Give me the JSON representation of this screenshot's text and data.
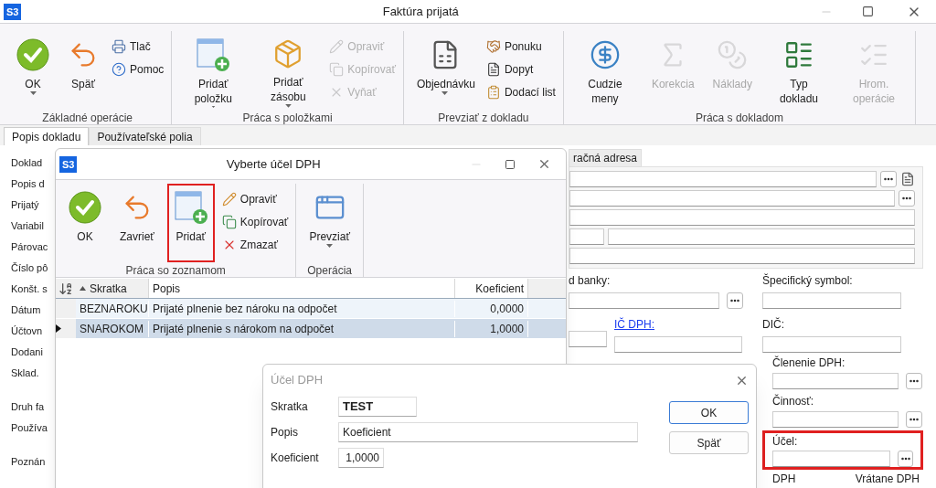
{
  "window": {
    "logo": "S3",
    "title": "Faktúra prijatá"
  },
  "ribbon": {
    "groups": [
      {
        "label": "Základné operácie",
        "items": [
          {
            "kind": "large",
            "label": "OK",
            "dropdown": true,
            "disabled": false
          },
          {
            "kind": "large",
            "label": "Späť",
            "dropdown": false,
            "disabled": false
          },
          {
            "kind": "small",
            "label": "Tlač",
            "disabled": false
          },
          {
            "kind": "small",
            "label": "Pomoc",
            "disabled": false
          }
        ]
      },
      {
        "label": "Práca s položkami",
        "items": [
          {
            "kind": "large",
            "label": "Pridať položku",
            "dropdown": true,
            "disabled": false
          },
          {
            "kind": "large",
            "label": "Pridať zásobu",
            "dropdown": true,
            "disabled": false
          },
          {
            "kind": "small",
            "label": "Opraviť",
            "disabled": true
          },
          {
            "kind": "small",
            "label": "Kopírovať",
            "disabled": true
          },
          {
            "kind": "small",
            "label": "Vyňať",
            "disabled": true
          }
        ]
      },
      {
        "label": "Prevziať z dokladu",
        "items": [
          {
            "kind": "large",
            "label": "Objednávku",
            "dropdown": true,
            "disabled": false
          },
          {
            "kind": "small",
            "label": "Ponuku",
            "disabled": false
          },
          {
            "kind": "small",
            "label": "Dopyt",
            "disabled": false
          },
          {
            "kind": "small",
            "label": "Dodací list",
            "disabled": false
          }
        ]
      },
      {
        "label": "Práca s dokladom",
        "items": [
          {
            "kind": "large",
            "label": "Cudzie meny",
            "dropdown": false,
            "disabled": false
          },
          {
            "kind": "large",
            "label": "Korekcia",
            "dropdown": false,
            "disabled": true
          },
          {
            "kind": "large",
            "label": "Náklady",
            "dropdown": false,
            "disabled": true
          },
          {
            "kind": "large",
            "label": "Typ dokladu",
            "dropdown": false,
            "disabled": false
          },
          {
            "kind": "large",
            "label": "Hrom. operácie",
            "dropdown": false,
            "disabled": true
          }
        ]
      }
    ]
  },
  "tabs": [
    {
      "label": "Popis dokladu",
      "selected": true
    },
    {
      "label": "Používateľské polia",
      "selected": false
    }
  ],
  "form_labels": [
    "Doklad",
    "Popis d",
    "Prijatý",
    "Variabil",
    "Párovac",
    "Číslo pô",
    "Konšt. s",
    "Dátum",
    "Účtovn",
    "Dodani",
    "Sklad.",
    "Druh fa",
    "Používa",
    "Poznán"
  ],
  "right_panel": {
    "tab": "račná adresa",
    "bank_label": "d banky:",
    "specific_symbol_label": "Špecifický symbol:",
    "vat_id_label": "IČ DPH:",
    "tax_id_label": "DIČ:",
    "vat_breakdown_label": "Členenie DPH:",
    "activity_label": "Činnosť:",
    "purpose": {
      "label": "Účel:",
      "highlighted": true
    },
    "columns": [
      "DPH",
      "Vrátane DPH"
    ]
  },
  "select_dialog": {
    "logo": "S3",
    "title": "Vyberte účel DPH",
    "groups": [
      {
        "label": "Práca so zoznamom",
        "items": [
          {
            "kind": "large",
            "label": "OK",
            "dropdown": false,
            "disabled": false,
            "highlighted": false
          },
          {
            "kind": "large",
            "label": "Zavrieť",
            "dropdown": false,
            "disabled": false,
            "highlighted": false
          },
          {
            "kind": "large",
            "label": "Pridať",
            "dropdown": false,
            "disabled": false,
            "highlighted": true
          },
          {
            "kind": "small",
            "label": "Opraviť",
            "disabled": false
          },
          {
            "kind": "small",
            "label": "Kopírovať",
            "disabled": false
          },
          {
            "kind": "small",
            "label": "Zmazať",
            "disabled": false
          }
        ]
      },
      {
        "label": "Operácia",
        "items": [
          {
            "kind": "large",
            "label": "Prevziať",
            "dropdown": true,
            "disabled": false,
            "highlighted": false
          }
        ]
      }
    ],
    "table": {
      "columns": [
        {
          "label": "Skratka",
          "sorted": true
        },
        {
          "label": "Popis",
          "sorted": false
        },
        {
          "label": "Koeficient",
          "sorted": false
        }
      ],
      "rows": [
        {
          "cells": [
            "BEZNAROKU",
            "Prijaté plnenie bez nároku na odpočet",
            "0,0000"
          ],
          "selected": false
        },
        {
          "cells": [
            "SNAROKOM",
            "Prijaté plnenie s nárokom na odpočet",
            "1,0000"
          ],
          "selected": true
        }
      ]
    }
  },
  "edit_dialog": {
    "title": "Účel DPH",
    "fields": [
      {
        "label": "Skratka",
        "value": "TEST"
      },
      {
        "label": "Popis",
        "value": "Koeficient"
      },
      {
        "label": "Koeficient",
        "value": "1,0000"
      }
    ],
    "buttons": [
      {
        "label": "OK",
        "focused": true
      },
      {
        "label": "Späť",
        "focused": false
      }
    ]
  }
}
